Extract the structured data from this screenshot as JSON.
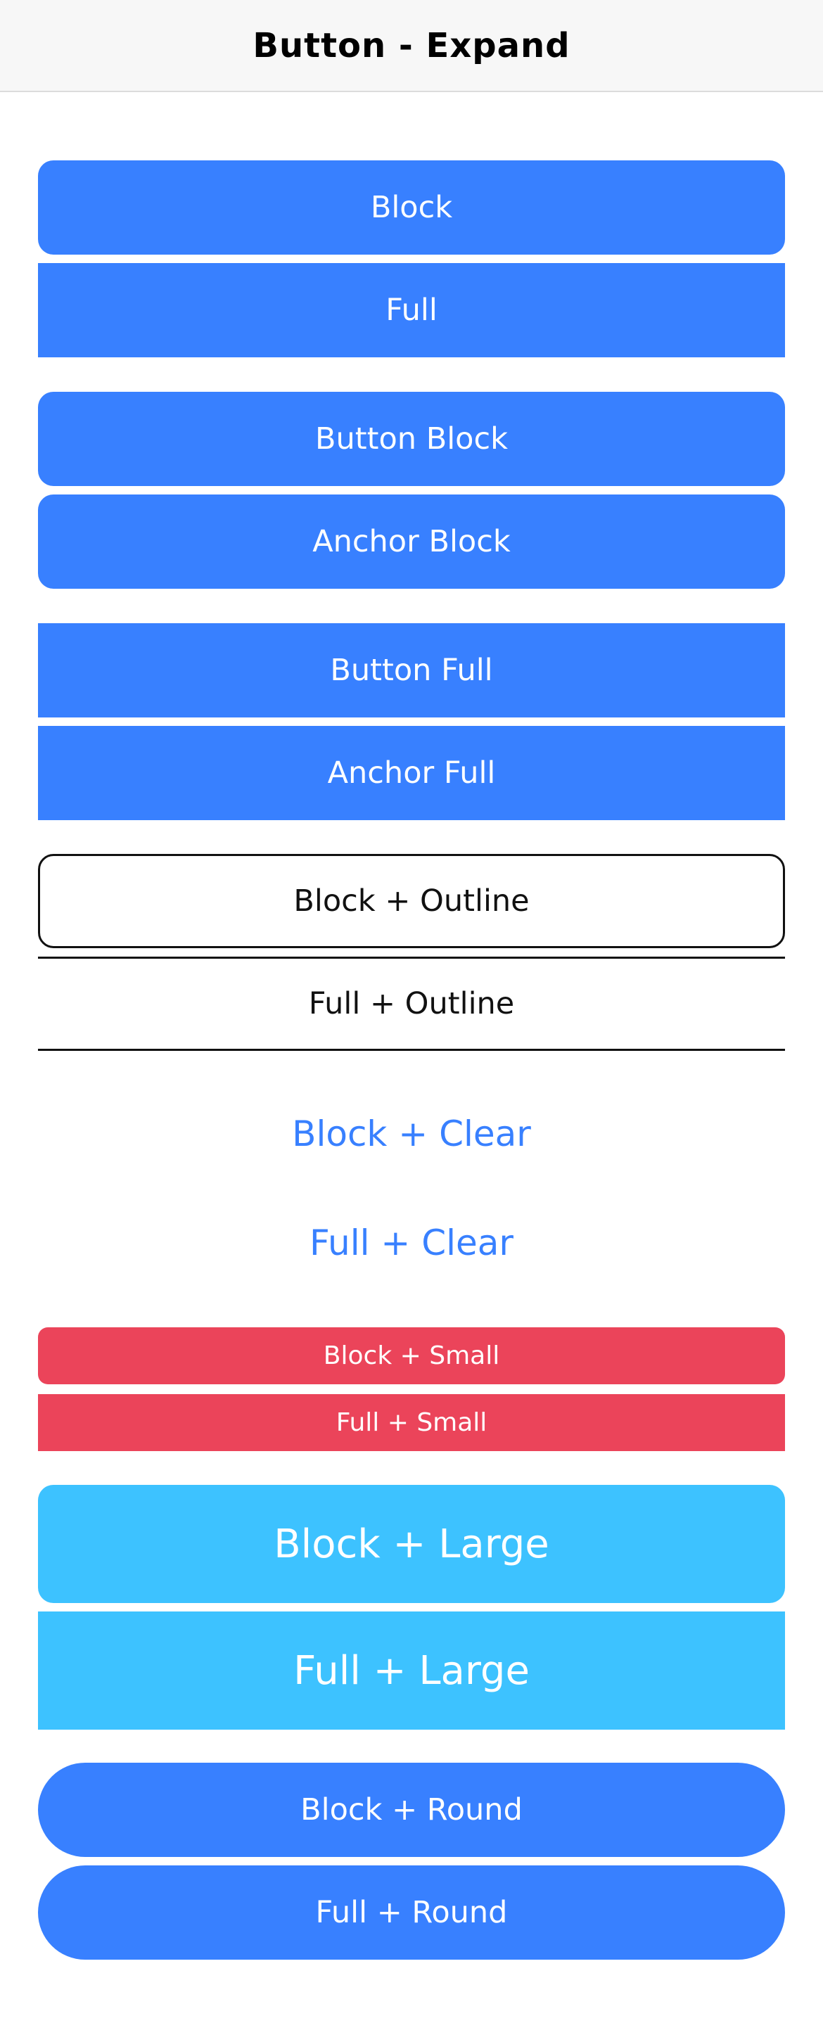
{
  "toolbar": {
    "title": "Button - Expand"
  },
  "buttons": {
    "block": "Block",
    "full": "Full",
    "button_block": "Button Block",
    "anchor_block": "Anchor Block",
    "button_full": "Button Full",
    "anchor_full": "Anchor Full",
    "block_outline": "Block + Outline",
    "full_outline": "Full + Outline",
    "block_clear": "Block + Clear",
    "full_clear": "Full + Clear",
    "block_small": "Block + Small",
    "full_small": "Full + Small",
    "block_large": "Block + Large",
    "full_large": "Full + Large",
    "block_round": "Block + Round",
    "full_round": "Full + Round"
  },
  "colors": {
    "primary": "#3880ff",
    "danger": "#eb445a",
    "secondary": "#3dc2ff",
    "outline": "#111111",
    "toolbar_bg": "#f7f7f7"
  }
}
